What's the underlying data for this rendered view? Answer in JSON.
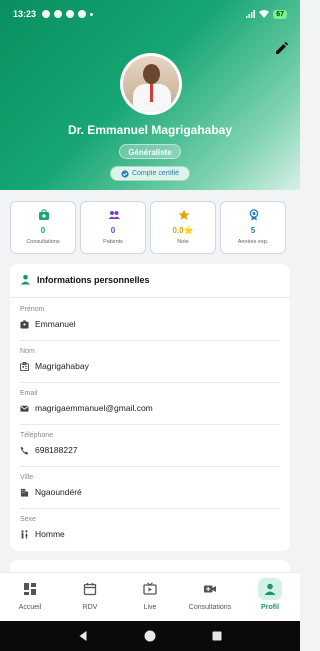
{
  "status": {
    "time": "13:23",
    "battery": "67"
  },
  "profile": {
    "name": "Dr. Emmanuel Magrigahabay",
    "specialty": "Généraliste",
    "certified": "Compte certifié"
  },
  "stats": [
    {
      "value": "0",
      "label": "Consultations",
      "color": "#1ea672",
      "icon": "medical-kit-icon"
    },
    {
      "value": "0",
      "label": "Patients",
      "color": "#7b3fbf",
      "icon": "people-icon"
    },
    {
      "value": "0.0⭐",
      "label": "Note",
      "color": "#e6a400",
      "icon": "star-icon"
    },
    {
      "value": "5",
      "label": "Années exp.",
      "color": "#1f7fc2",
      "icon": "award-icon"
    }
  ],
  "info": {
    "title": "Informations personnelles",
    "fields": [
      {
        "label": "Prénom",
        "value": "Emmanuel",
        "icon": "badge-icon"
      },
      {
        "label": "Nom",
        "value": "Magrigahabay",
        "icon": "id-card-icon"
      },
      {
        "label": "Email",
        "value": "magrigaemmanuel@gmail.com",
        "icon": "mail-icon"
      },
      {
        "label": "Téléphone",
        "value": "698188227",
        "icon": "phone-icon"
      },
      {
        "label": "Ville",
        "value": "Ngaoundéré",
        "icon": "building-icon"
      },
      {
        "label": "Sexe",
        "value": "Homme",
        "icon": "wc-icon"
      }
    ]
  },
  "nav": [
    {
      "label": "Accueil",
      "icon": "dashboard-icon"
    },
    {
      "label": "RDV",
      "icon": "calendar-icon"
    },
    {
      "label": "Live",
      "icon": "live-tv-icon"
    },
    {
      "label": "Consultations",
      "icon": "video-call-icon"
    },
    {
      "label": "Profil",
      "icon": "person-icon",
      "active": true
    }
  ],
  "colors": {
    "accent": "#129b65",
    "header_start": "#0a8f5f"
  }
}
